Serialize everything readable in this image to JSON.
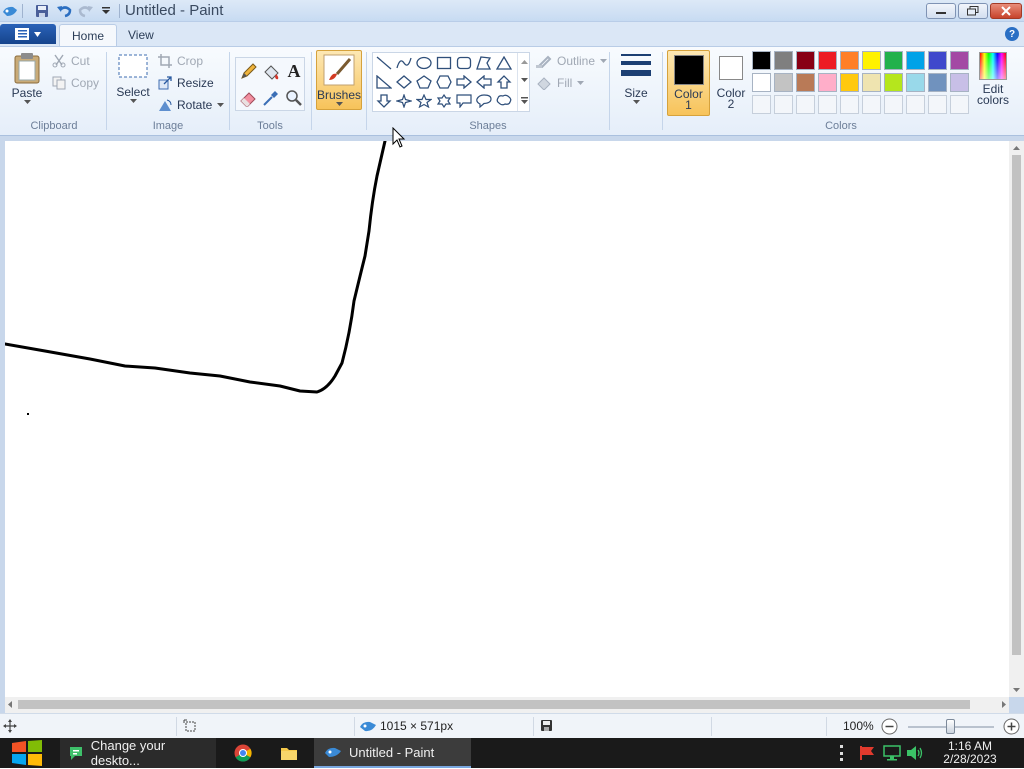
{
  "window": {
    "title": "Untitled - Paint"
  },
  "tabs": [
    {
      "label": "Home"
    },
    {
      "label": "View"
    }
  ],
  "clipboard": {
    "paste": "Paste",
    "cut": "Cut",
    "copy": "Copy",
    "group": "Clipboard"
  },
  "image": {
    "select": "Select",
    "crop": "Crop",
    "resize": "Resize",
    "rotate": "Rotate",
    "group": "Image"
  },
  "tools": {
    "group": "Tools",
    "text_glyph": "A"
  },
  "brushes": {
    "label": "Brushes"
  },
  "shapes": {
    "group": "Shapes",
    "outline": "Outline",
    "fill": "Fill"
  },
  "size": {
    "label": "Size"
  },
  "colors": {
    "group": "Colors",
    "color1": "Color",
    "color1_num": "1",
    "color2": "Color",
    "color2_num": "2",
    "edit1": "Edit",
    "edit2": "colors",
    "color1_value": "#000000",
    "color2_value": "#ffffff",
    "row1": [
      "#000000",
      "#7f7f7f",
      "#880015",
      "#ed1c24",
      "#ff7f27",
      "#fff200",
      "#22b14c",
      "#00a2e8",
      "#3f48cc",
      "#a349a4"
    ],
    "row2": [
      "#ffffff",
      "#c3c3c3",
      "#b97a57",
      "#ffaec9",
      "#ffc90e",
      "#efe4b0",
      "#b5e61d",
      "#99d9ea",
      "#7092be",
      "#c8bfe7"
    ]
  },
  "status": {
    "dimensions": "1015 × 571px",
    "zoom": "100%"
  },
  "taskbar": {
    "app1": "Change your deskto...",
    "app2": "Untitled - Paint",
    "time": "1:16 AM",
    "date": "2/28/2023"
  }
}
